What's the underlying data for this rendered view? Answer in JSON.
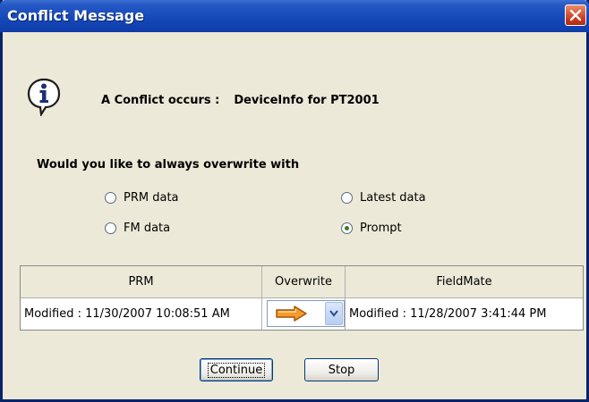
{
  "window": {
    "title": "Conflict Message"
  },
  "message": {
    "prefix": "A Conflict occurs :",
    "target": "DeviceInfo for PT2001"
  },
  "question": "Would you like to always overwrite with",
  "options": [
    {
      "label": "PRM data",
      "checked": false
    },
    {
      "label": "FM data",
      "checked": false
    },
    {
      "label": "Latest data",
      "checked": false
    },
    {
      "label": "Prompt",
      "checked": true
    }
  ],
  "table": {
    "headers": [
      "PRM",
      "Overwrite",
      "FieldMate"
    ],
    "row": {
      "prm": "Modified : 11/30/2007 10:08:51 AM",
      "fieldmate": "Modified : 11/28/2007 3:41:44 PM",
      "overwrite_icon": "arrow-right-icon"
    }
  },
  "buttons": {
    "continue": "Continue",
    "stop": "Stop"
  },
  "colors": {
    "titlebar": "#1447b8",
    "close": "#c8391e",
    "arrow": "#f08a1c"
  }
}
